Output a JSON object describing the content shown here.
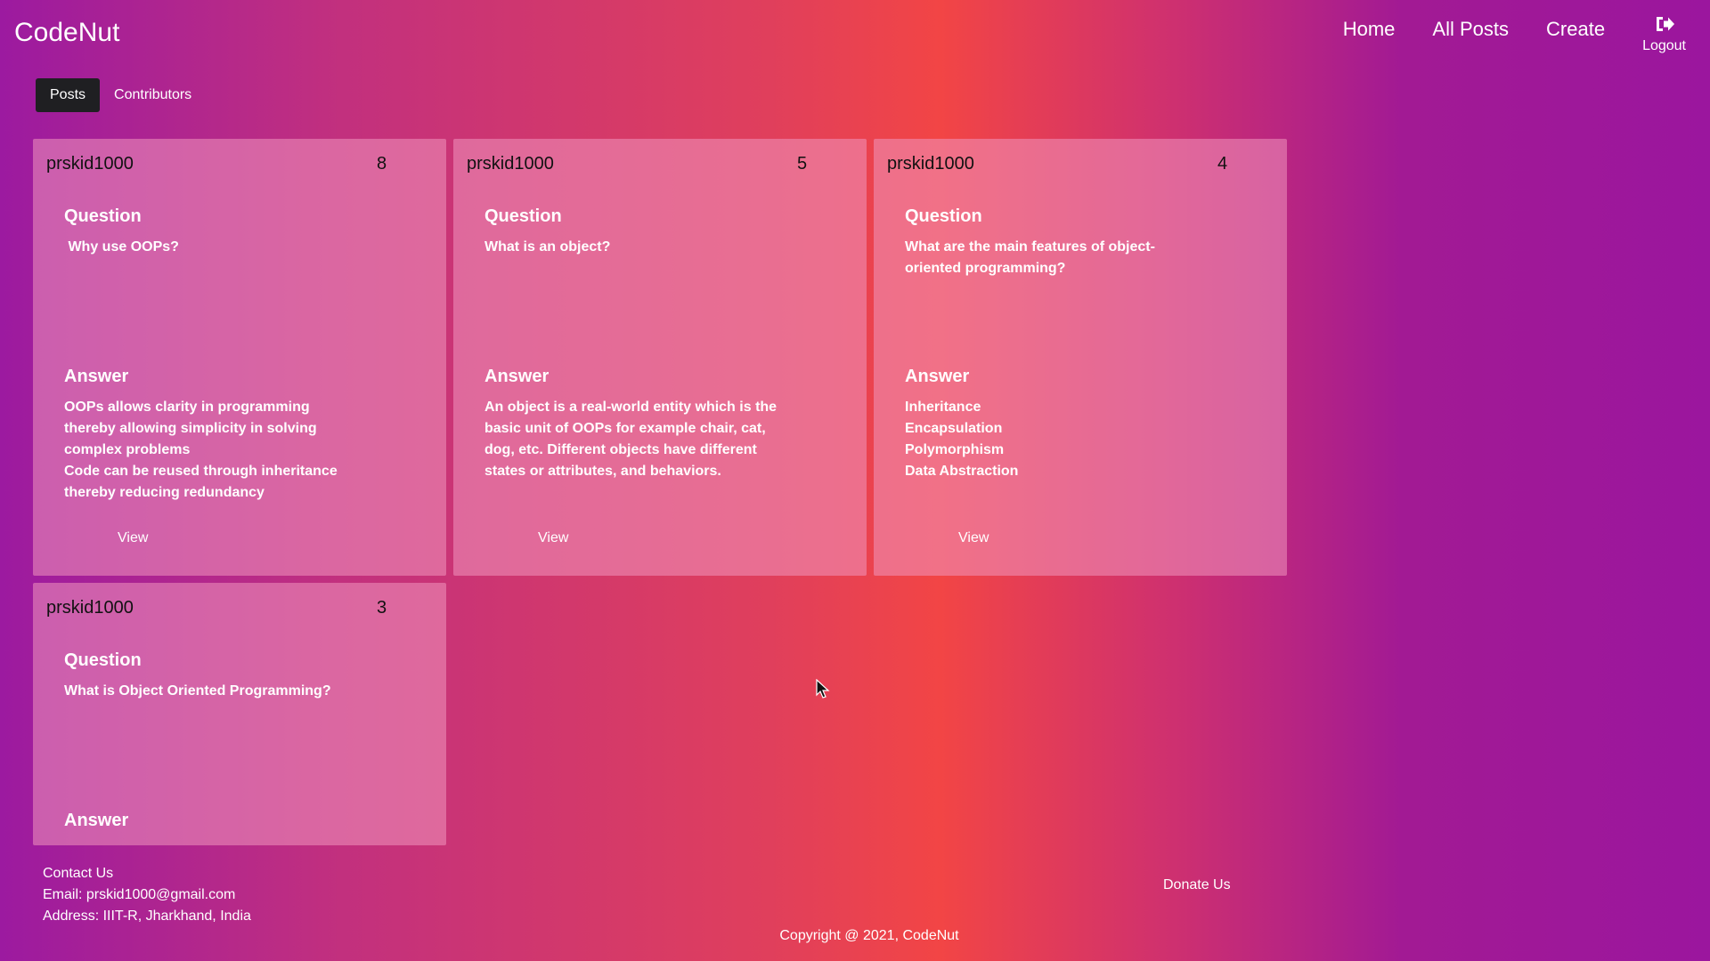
{
  "app": {
    "brand": "CodeNut"
  },
  "nav": {
    "items": [
      "Home",
      "All Posts",
      "Create"
    ],
    "logout_label": "Logout",
    "logout_icon": "logout-icon"
  },
  "tabs": [
    {
      "label": "Posts",
      "active": true
    },
    {
      "label": "Contributors",
      "active": false
    }
  ],
  "posts": [
    {
      "user": "prskid1000",
      "count": "8",
      "question_label": "Question",
      "question": " Why use OOPs?",
      "answer_label": "Answer",
      "answer": "OOPs allows clarity in programming thereby allowing simplicity in solving complex problems\nCode can be reused through inheritance thereby reducing redundancy",
      "view_label": "View"
    },
    {
      "user": "prskid1000",
      "count": "5",
      "question_label": "Question",
      "question": "What is an object?",
      "answer_label": "Answer",
      "answer": "An object is a real-world entity which is the basic unit of OOPs for example chair, cat, dog, etc. Different objects have different states or attributes, and behaviors.",
      "view_label": "View"
    },
    {
      "user": "prskid1000",
      "count": "4",
      "question_label": "Question",
      "question": "What are the main features of object-oriented programming?",
      "answer_label": "Answer",
      "answer": "Inheritance\nEncapsulation\nPolymorphism\nData Abstraction",
      "view_label": "View"
    },
    {
      "user": "prskid1000",
      "count": "3",
      "question_label": "Question",
      "question": "What is Object Oriented Programming?",
      "answer_label": "Answer"
    }
  ],
  "footer": {
    "contact_title": "Contact Us",
    "email": "Email: prskid1000@gmail.com",
    "address": "Address: IIIT-R, Jharkhand, India",
    "donate_label": "Donate Us",
    "copyright": "Copyright @ 2021, CodeNut"
  }
}
